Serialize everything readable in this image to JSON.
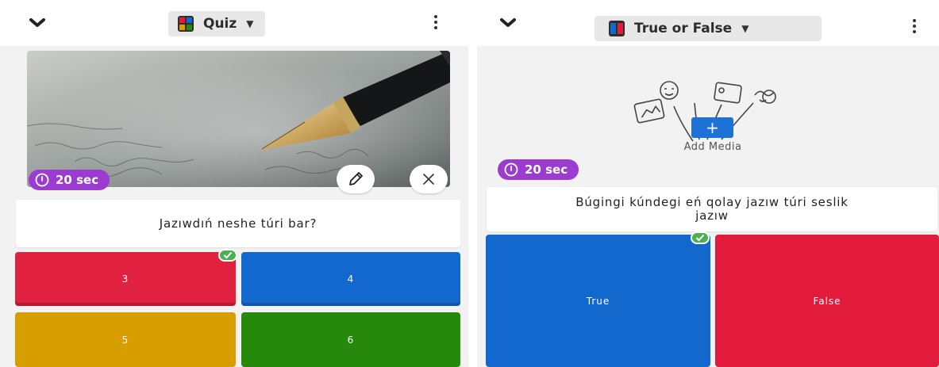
{
  "left_screen": {
    "question_type": "Quiz",
    "timer": "20 sec",
    "question": "Jazıwdıń neshe túri bar?",
    "answers": [
      {
        "label": "3",
        "color": "#e0213f",
        "correct": true
      },
      {
        "label": "4",
        "color": "#1368ce"
      },
      {
        "label": "5",
        "color": "#d89e00"
      },
      {
        "label": "6",
        "color": "#26890c"
      }
    ],
    "icons": {
      "collapse": "chevron-down-icon",
      "menu": "more-vertical-icon",
      "edit": "pencil-icon",
      "remove": "close-icon",
      "timer": "clock-icon"
    }
  },
  "right_screen": {
    "question_type": "True or False",
    "timer": "20 sec",
    "add_media_label": "Add Media",
    "add_media_button": "+",
    "question": "Búgingi kúndegi eń qolay jazıw túri seslik jazıw",
    "answers": [
      {
        "label": "True",
        "color": "#1368ce",
        "correct": true
      },
      {
        "label": "False",
        "color": "#e21b3c"
      }
    ]
  },
  "colors": {
    "timer_purple": "#9b3bcf",
    "check_green": "#4caf50",
    "accent_blue": "#1e72d6"
  }
}
